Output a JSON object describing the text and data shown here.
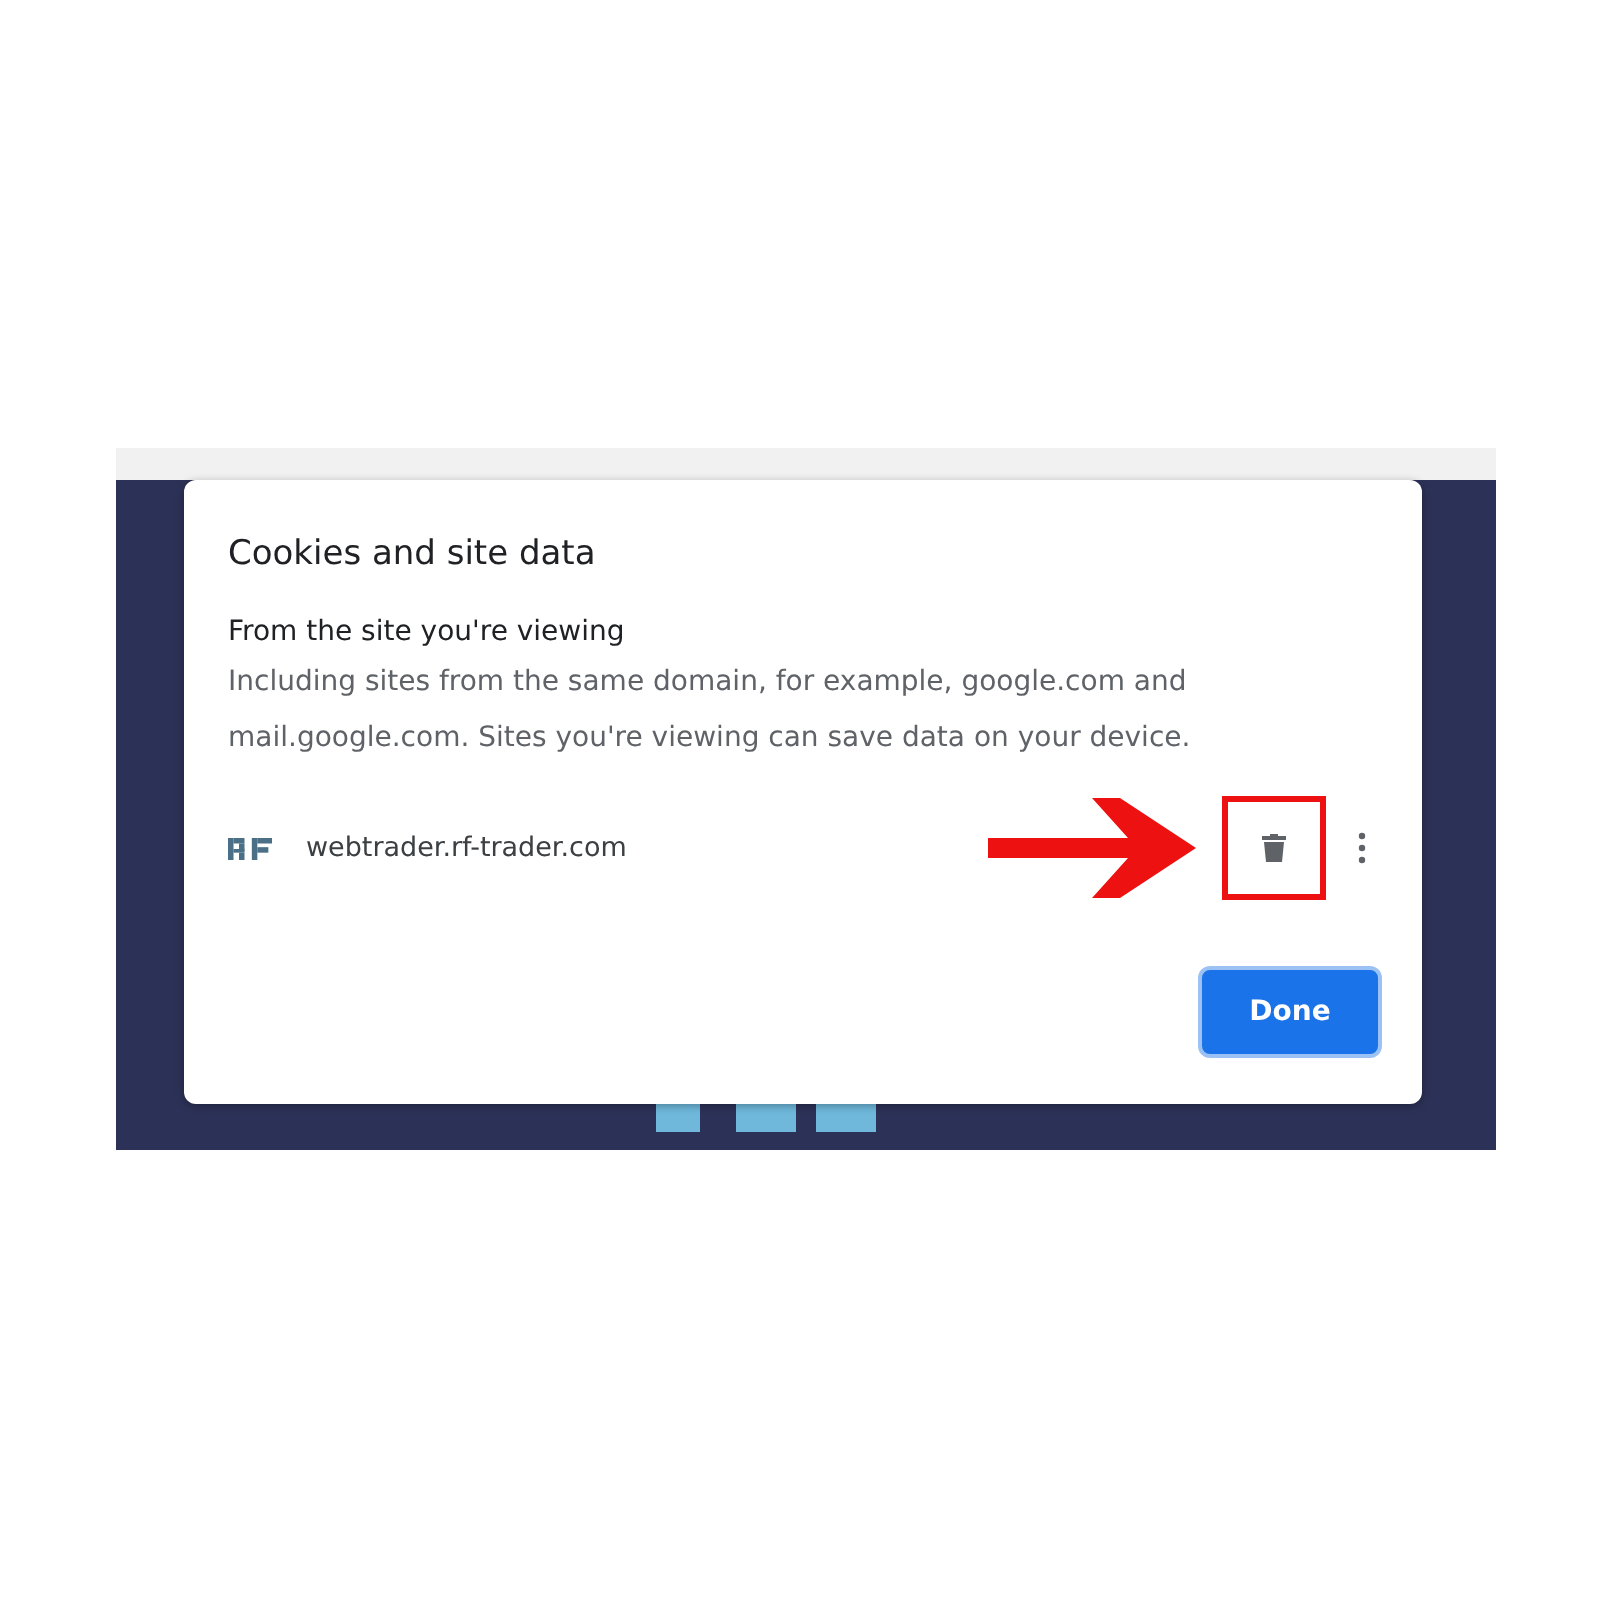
{
  "dialog": {
    "title": "Cookies and site data",
    "section_heading": "From the site you're viewing",
    "section_description": "Including sites from the same domain, for example, google.com and mail.google.com. Sites you're viewing can save data on your device.",
    "sites": [
      {
        "domain": "webtrader.rf-trader.com",
        "highlighted": true
      }
    ],
    "buttons": [
      {
        "label": "Done",
        "kind": "primary"
      }
    ]
  }
}
